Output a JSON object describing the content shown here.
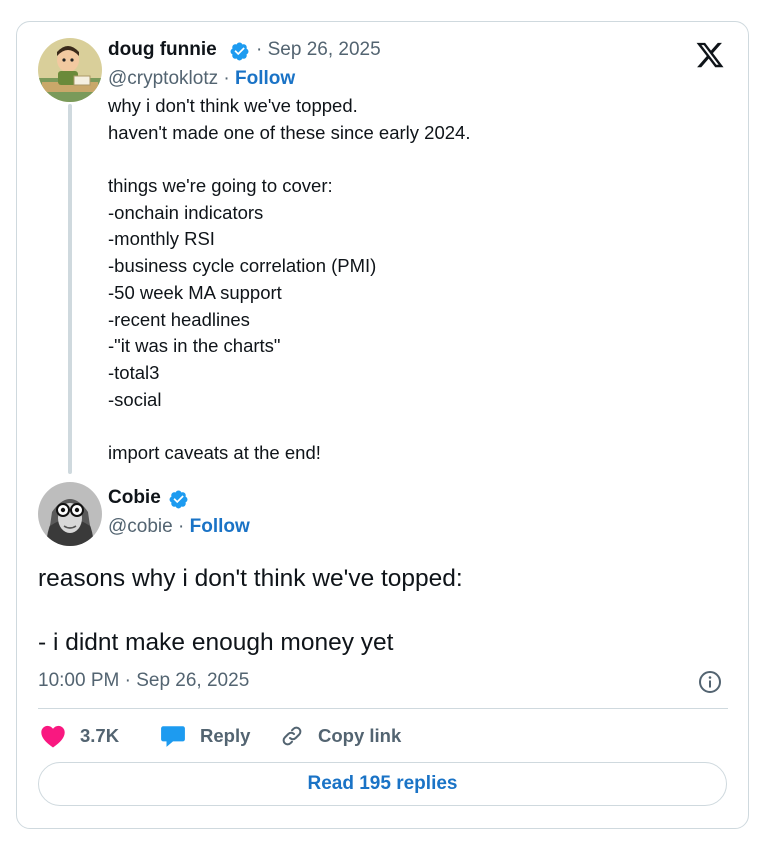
{
  "parent_tweet": {
    "author_name": "doug funnie",
    "date": "· Sep 26, 2025",
    "handle": "@cryptoklotz ·",
    "follow_label": "Follow",
    "lines": [
      "why i don't think we've topped.",
      "haven't made one of these since early 2024.",
      "",
      "things we're going to cover:",
      "-onchain indicators",
      "-monthly RSI",
      "-business cycle correlation (PMI)",
      "-50 week MA support",
      "-recent headlines",
      "-\"it was in the charts\"",
      "-total3",
      "-social",
      "",
      "import caveats at the end!"
    ]
  },
  "main_tweet": {
    "author_name": "Cobie",
    "handle": "@cobie ·",
    "follow_label": "Follow",
    "lines": [
      "reasons why i don't think we've topped:",
      "",
      "- i didnt make enough money yet"
    ],
    "timestamp": "10:00 PM · Sep 26, 2025"
  },
  "actions": {
    "likes": "3.7K",
    "reply_label": "Reply",
    "copy_label": "Copy link"
  },
  "read_replies_label": "Read 195 replies",
  "icons": [
    "x-logo-icon",
    "verified-badge-icon",
    "heart-icon",
    "reply-bubble-icon",
    "link-icon",
    "info-icon"
  ],
  "colors": {
    "verified": "#1d9bf0",
    "heart": "#f91880",
    "link_blue": "#1a73c6",
    "secondary_text": "#536471",
    "border": "#cfd9de"
  }
}
